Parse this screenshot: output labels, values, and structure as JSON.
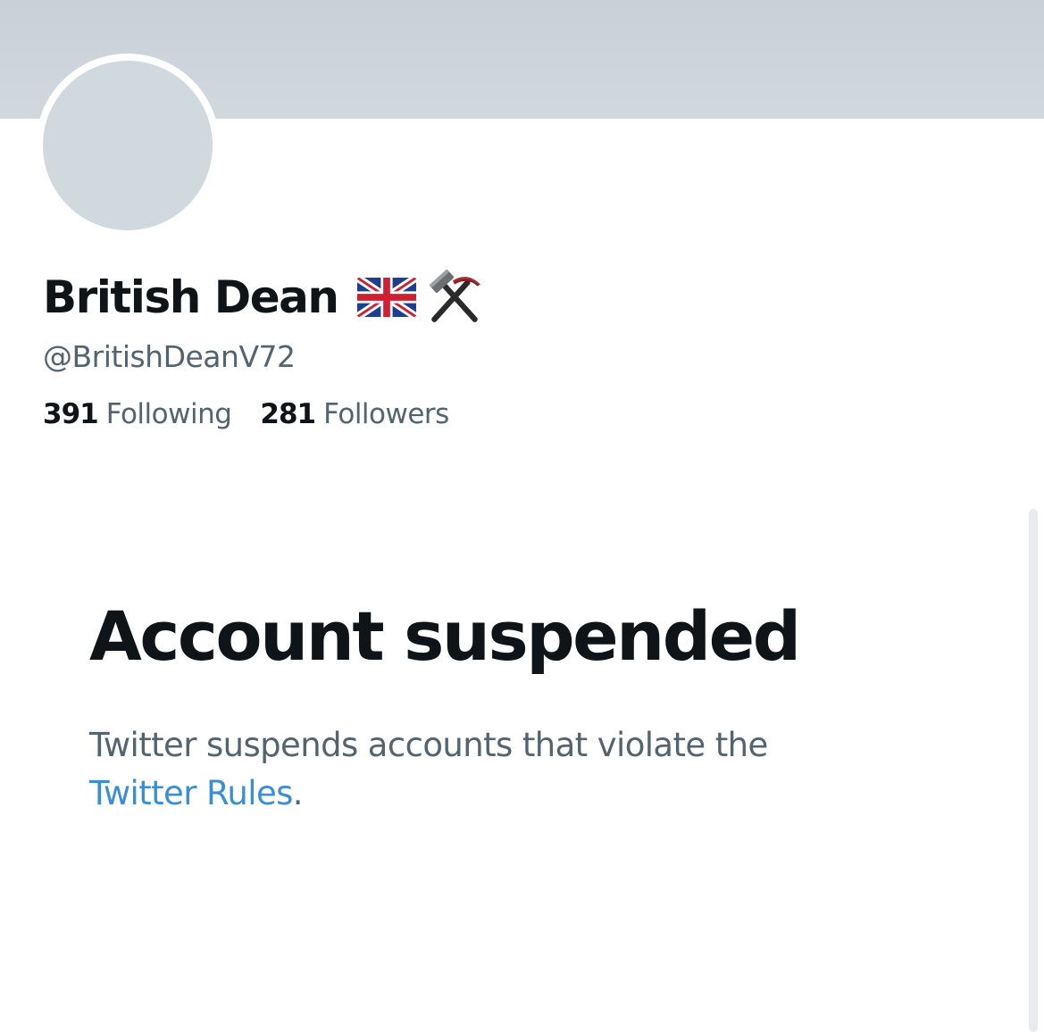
{
  "profile": {
    "display_name": "British Dean",
    "name_emojis": [
      "uk-flag",
      "hammer-and-pick"
    ],
    "handle": "@BritishDeanV72",
    "following_count": "391",
    "following_label": "Following",
    "followers_count": "281",
    "followers_label": "Followers"
  },
  "suspension": {
    "title": "Account suspended",
    "message": "Twitter suspends accounts that violate the",
    "link_text": "Twitter Rules",
    "trailing": "."
  },
  "colors": {
    "banner": "#cdd4da",
    "avatar_placeholder": "#cfd9de",
    "primary_text": "#0f1419",
    "secondary_text": "#536471",
    "link": "#3a8fd4"
  }
}
